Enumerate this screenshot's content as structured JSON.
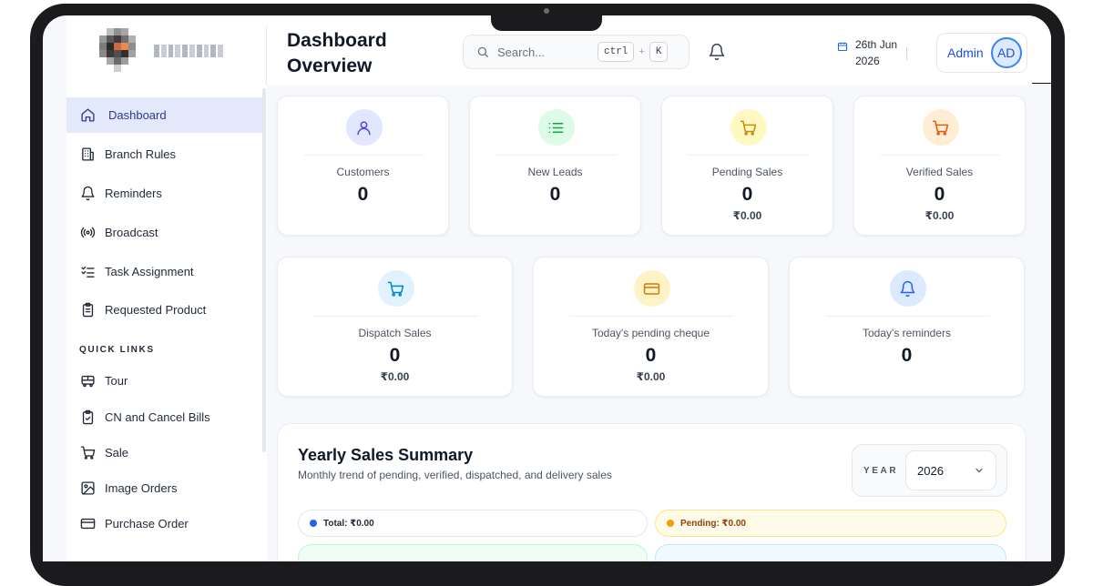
{
  "header": {
    "title": "Dashboard Overview",
    "search_placeholder": "Search...",
    "shortcut_key1": "ctrl",
    "shortcut_plus": "+",
    "shortcut_key2": "K",
    "date_line1": "26th Jun",
    "date_line2": "2026",
    "user_name": "Admin",
    "user_initials": "AD"
  },
  "sidebar": {
    "items": [
      {
        "label": "Dashboard",
        "icon": "home-icon",
        "active": true
      },
      {
        "label": "Branch Rules",
        "icon": "building-icon"
      },
      {
        "label": "Reminders",
        "icon": "bell-icon"
      },
      {
        "label": "Broadcast",
        "icon": "broadcast-icon"
      },
      {
        "label": "Task Assignment",
        "icon": "checklist-icon"
      },
      {
        "label": "Requested Product",
        "icon": "clipboard-icon"
      }
    ],
    "quick_links_title": "QUICK LINKS",
    "quick_links": [
      {
        "label": "Tour",
        "icon": "bus-icon"
      },
      {
        "label": "CN and Cancel Bills",
        "icon": "clipboard-check-icon"
      },
      {
        "label": "Sale",
        "icon": "cart-icon"
      },
      {
        "label": "Image Orders",
        "icon": "image-icon"
      },
      {
        "label": "Purchase Order",
        "icon": "credit-card-icon"
      }
    ]
  },
  "stats_row1": [
    {
      "title": "Customers",
      "value": "0",
      "icon": "user-icon",
      "bg": "#e0e7ff",
      "color": "#4f46e5"
    },
    {
      "title": "New Leads",
      "value": "0",
      "icon": "list-icon",
      "bg": "#dcfce7",
      "color": "#16a34a"
    },
    {
      "title": "Pending Sales",
      "value": "0",
      "amount": "₹0.00",
      "icon": "cart-icon",
      "bg": "#fef9c3",
      "color": "#ca8a04"
    },
    {
      "title": "Verified Sales",
      "value": "0",
      "amount": "₹0.00",
      "icon": "cart-icon",
      "bg": "#ffedd5",
      "color": "#ea580c"
    }
  ],
  "stats_row2": [
    {
      "title": "Dispatch Sales",
      "value": "0",
      "amount": "₹0.00",
      "icon": "cart-icon",
      "bg": "#e0f2fe",
      "color": "#0284c7"
    },
    {
      "title": "Today's pending cheque",
      "value": "0",
      "amount": "₹0.00",
      "icon": "card-icon",
      "bg": "#fef3c7",
      "color": "#d97706"
    },
    {
      "title": "Today's reminders",
      "value": "0",
      "icon": "bell-icon",
      "bg": "#dbeafe",
      "color": "#2563eb"
    }
  ],
  "summary": {
    "title": "Yearly Sales Summary",
    "subtitle": "Monthly trend of pending, verified, dispatched, and delivery sales",
    "year_label": "YEAR",
    "year_value": "2026",
    "total_label": "Total: ₹0.00",
    "pending_label": "Pending: ₹0.00"
  },
  "colors": {
    "accent": "#2e3a8c",
    "active_bg": "#e3e8fb",
    "total_dot": "#2563eb",
    "pending_dot": "#f59e0b"
  }
}
